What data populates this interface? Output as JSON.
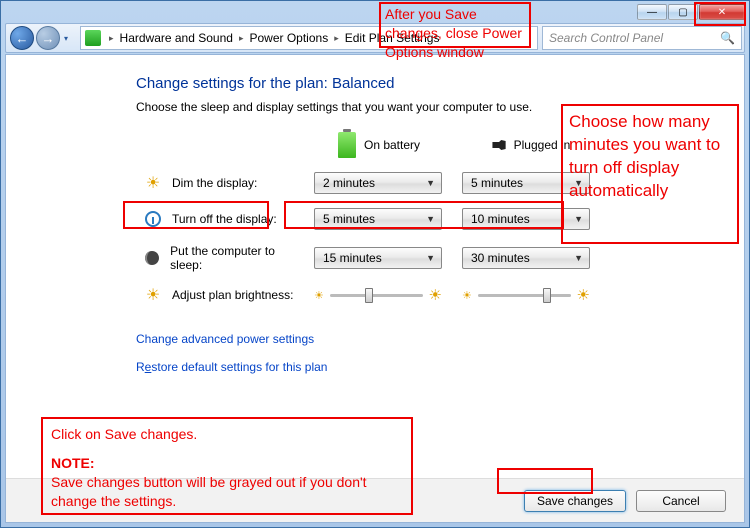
{
  "titlebar": {
    "minimize_glyph": "—",
    "maximize_glyph": "▢",
    "close_glyph": "✕"
  },
  "navbar": {
    "back_glyph": "←",
    "forward_glyph": "→",
    "history_glyph": "▾",
    "breadcrumb": {
      "seg1": "Hardware and Sound",
      "seg2": "Power Options",
      "seg3": "Edit Plan Settings"
    },
    "search_placeholder": "Search Control Panel",
    "search_icon": "🔍"
  },
  "page": {
    "title": "Change settings for the plan: Balanced",
    "subtitle": "Choose the sleep and display settings that you want your computer to use."
  },
  "columns": {
    "battery": "On battery",
    "plugged": "Plugged in"
  },
  "rows": {
    "dim": {
      "label": "Dim the display:",
      "battery": "2 minutes",
      "plugged": "5 minutes"
    },
    "off": {
      "label": "Turn off the display:",
      "battery": "5 minutes",
      "plugged": "10 minutes"
    },
    "sleep": {
      "label": "Put the computer to sleep:",
      "battery": "15 minutes",
      "plugged": "30 minutes"
    },
    "brightness": {
      "label": "Adjust plan brightness:"
    }
  },
  "sliders": {
    "battery_pos_pct": 38,
    "plugged_pos_pct": 70
  },
  "links": {
    "advanced": "Change advanced power settings",
    "restore_pre": "R",
    "restore_underline": "e",
    "restore_post": "store default settings for this plan"
  },
  "footer": {
    "save": "Save changes",
    "cancel": "Cancel"
  },
  "annotations": {
    "top": "After you Save changes, close Power Options window",
    "right": "Choose how many minutes you want to turn off display automatically",
    "bottom1": "Click on Save changes.",
    "bottom_note_label": "NOTE:",
    "bottom2": "Save changes button will be grayed out if you don't change the settings."
  },
  "glyphs": {
    "caret": "▼",
    "sun": "☀",
    "bullet": "●"
  }
}
